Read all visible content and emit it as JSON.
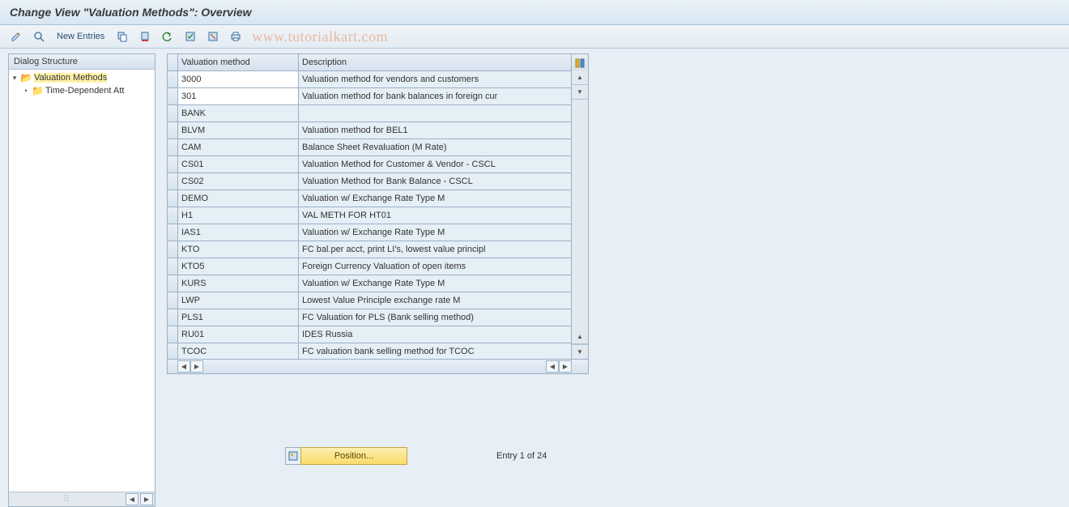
{
  "title": "Change View \"Valuation Methods\": Overview",
  "toolbar": {
    "new_entries": "New Entries"
  },
  "watermark": "www.tutorialkart.com",
  "tree": {
    "header": "Dialog Structure",
    "root": "Valuation Methods",
    "child": "Time-Dependent Att"
  },
  "grid": {
    "col_a": "Valuation method",
    "col_b": "Description",
    "rows": [
      {
        "a": "3000",
        "b": "Valuation method for vendors and customers"
      },
      {
        "a": "301",
        "b": "Valuation method for bank balances in foreign cur"
      },
      {
        "a": "BANK",
        "b": ""
      },
      {
        "a": "BLVM",
        "b": "Valuation method for BEL1"
      },
      {
        "a": "CAM",
        "b": "Balance Sheet Revaluation (M Rate)"
      },
      {
        "a": "CS01",
        "b": "Valuation Method for Customer & Vendor - CSCL"
      },
      {
        "a": "CS02",
        "b": "Valuation Method for Bank Balance - CSCL"
      },
      {
        "a": "DEMO",
        "b": "Valuation w/ Exchange Rate Type M"
      },
      {
        "a": "H1",
        "b": "VAL METH FOR HT01"
      },
      {
        "a": "IAS1",
        "b": "Valuation w/ Exchange Rate Type M"
      },
      {
        "a": "KTO",
        "b": "FC bal.per acct, print LI's, lowest value principl"
      },
      {
        "a": "KTO5",
        "b": "Foreign Currency Valuation of open items"
      },
      {
        "a": "KURS",
        "b": "Valuation w/ Exchange Rate Type M"
      },
      {
        "a": "LWP",
        "b": "Lowest Value Principle exchange rate M"
      },
      {
        "a": "PLS1",
        "b": "FC Valuation for PLS (Bank selling method)"
      },
      {
        "a": "RU01",
        "b": "IDES Russia"
      },
      {
        "a": "TCOC",
        "b": "FC valuation bank selling method for TCOC"
      }
    ]
  },
  "footer": {
    "position_label": "Position...",
    "entry_text": "Entry 1 of 24"
  }
}
